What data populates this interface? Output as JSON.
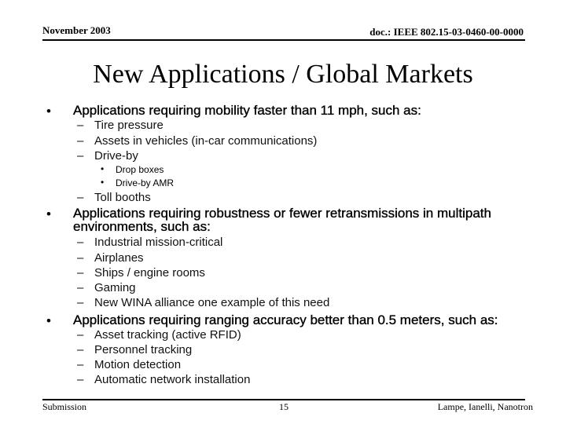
{
  "header": {
    "date": "November 2003",
    "doc_id": "doc.: IEEE 802.15-03-0460-00-0000"
  },
  "title": "New Applications / Global Markets",
  "sections": [
    {
      "heading": "Applications requiring mobility faster than 11 mph, such as:",
      "items": [
        {
          "text": "Tire pressure"
        },
        {
          "text": "Assets in vehicles (in-car communications)"
        },
        {
          "text": "Drive-by",
          "subitems": [
            "Drop boxes",
            "Drive-by AMR"
          ]
        },
        {
          "text": "Toll booths"
        }
      ]
    },
    {
      "heading": "Applications requiring robustness or fewer retransmissions in multipath",
      "heading_cont": "environments, such as:",
      "items": [
        {
          "text": "Industrial mission-critical"
        },
        {
          "text": "Airplanes"
        },
        {
          "text": "Ships / engine rooms"
        },
        {
          "text": "Gaming"
        },
        {
          "text": "New WINA alliance one example of this need"
        }
      ]
    },
    {
      "heading": "Applications requiring ranging accuracy better than 0.5 meters, such as:",
      "items": [
        {
          "text": "Asset tracking (active RFID)"
        },
        {
          "text": "Personnel tracking"
        },
        {
          "text": "Motion detection"
        },
        {
          "text": "Automatic network installation"
        }
      ]
    }
  ],
  "markers": {
    "bullet": "•",
    "dash": "–",
    "sub": "•"
  },
  "footer": {
    "left": "Submission",
    "page": "15",
    "authors": "Lampe, Ianelli, Nanotron"
  }
}
